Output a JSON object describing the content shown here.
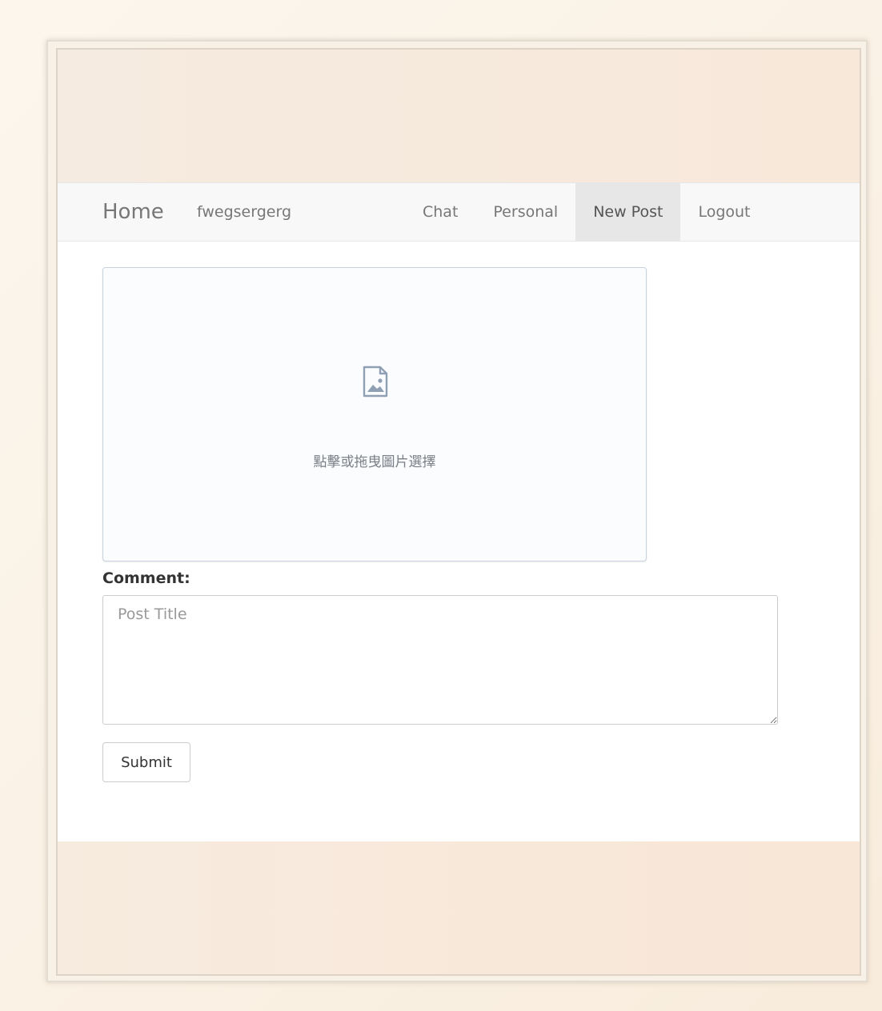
{
  "navbar": {
    "brand": "Home",
    "username": "fwegsergerg",
    "items": [
      {
        "label": "Chat",
        "active": false
      },
      {
        "label": "Personal",
        "active": false
      },
      {
        "label": "New Post",
        "active": true
      },
      {
        "label": "Logout",
        "active": false
      }
    ]
  },
  "upload": {
    "icon": "image-file-icon",
    "prompt": "點擊或拖曳圖片選擇"
  },
  "form": {
    "comment_label": "Comment:",
    "comment_placeholder": "Post Title",
    "comment_value": "",
    "submit_label": "Submit"
  },
  "colors": {
    "page_background": "#fcf6ed",
    "navbar_background": "#f8f8f8",
    "nav_active_background": "#e7e7e7",
    "nav_text": "#777777",
    "upload_border": "#c9d2de",
    "upload_icon": "#8fa0b5"
  }
}
